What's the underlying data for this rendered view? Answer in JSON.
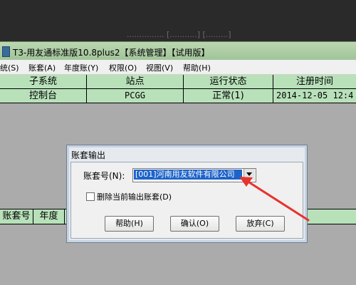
{
  "window": {
    "background_hint": "...............  [...........] [.........]",
    "title": "T3-用友通标准版10.8plus2【系统管理】【试用版】"
  },
  "menu": {
    "items": [
      "统(S)",
      "账套(A)",
      "年度账(Y)",
      "权限(O)",
      "视图(V)",
      "帮助(H)"
    ]
  },
  "table": {
    "headers": [
      "子系统",
      "站点",
      "运行状态",
      "注册时间"
    ],
    "row": [
      "控制台",
      "PCGG",
      "正常(1)",
      "2014-12-05 12:4"
    ]
  },
  "bottom_table": {
    "headers": [
      "账套号",
      "年度"
    ]
  },
  "dialog": {
    "title": "账套输出",
    "account_label": "账套号(N):",
    "account_value": "[001]河南用友软件有限公司",
    "checkbox_label": "删除当前输出账套(D)",
    "checkbox_checked": false,
    "buttons": {
      "help": "帮助(H)",
      "ok": "确认(O)",
      "cancel": "放弃(C)"
    }
  },
  "colors": {
    "title_bg": "#a6c89f",
    "table_bg": "#b8e1ba",
    "selection": "#1d63c9",
    "arrow": "#e8322d"
  }
}
